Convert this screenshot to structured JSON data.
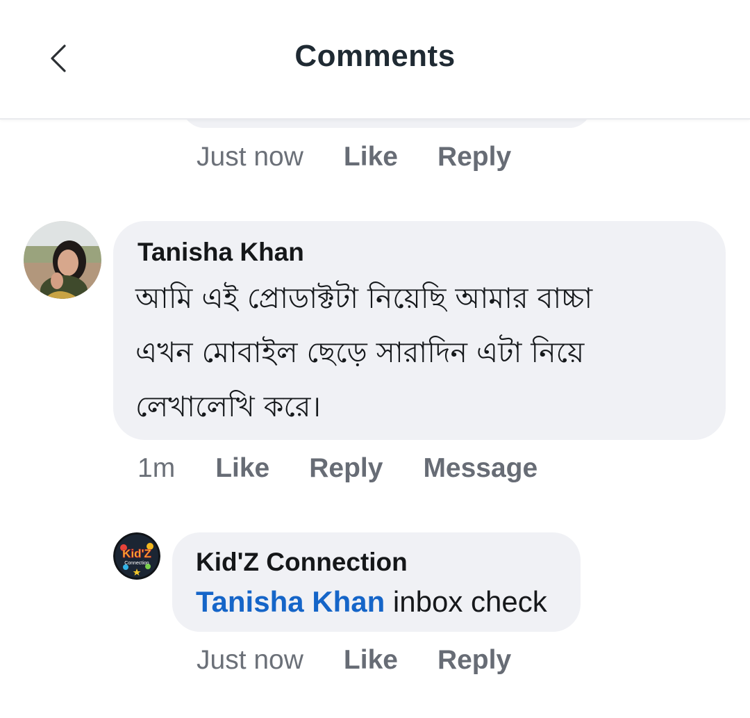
{
  "header": {
    "title": "Comments",
    "back_icon": "chevron-left-icon"
  },
  "prev_comment": {
    "time": "Just now",
    "like_label": "Like",
    "reply_label": "Reply"
  },
  "comment": {
    "author": "Tanisha Khan",
    "text_lines": [
      "আমি এই প্রোডাক্টটা নিয়েছি আমার বাচ্চা",
      "এখন মোবাইল ছেড়ে সারাদিন এটা নিয়ে",
      "লেখালেখি করে।"
    ],
    "time": "1m",
    "like_label": "Like",
    "reply_label": "Reply",
    "message_label": "Message"
  },
  "reply": {
    "author": "Kid'Z Connection",
    "mention": "Tanisha Khan",
    "text": " inbox check",
    "time": "Just now",
    "like_label": "Like",
    "reply_label": "Reply",
    "logo_text_1": "Kid'Z",
    "logo_text_2": "Connection"
  },
  "colors": {
    "bubble": "#f0f1f5",
    "mention": "#1565c8",
    "secondary_text": "#676c75"
  }
}
